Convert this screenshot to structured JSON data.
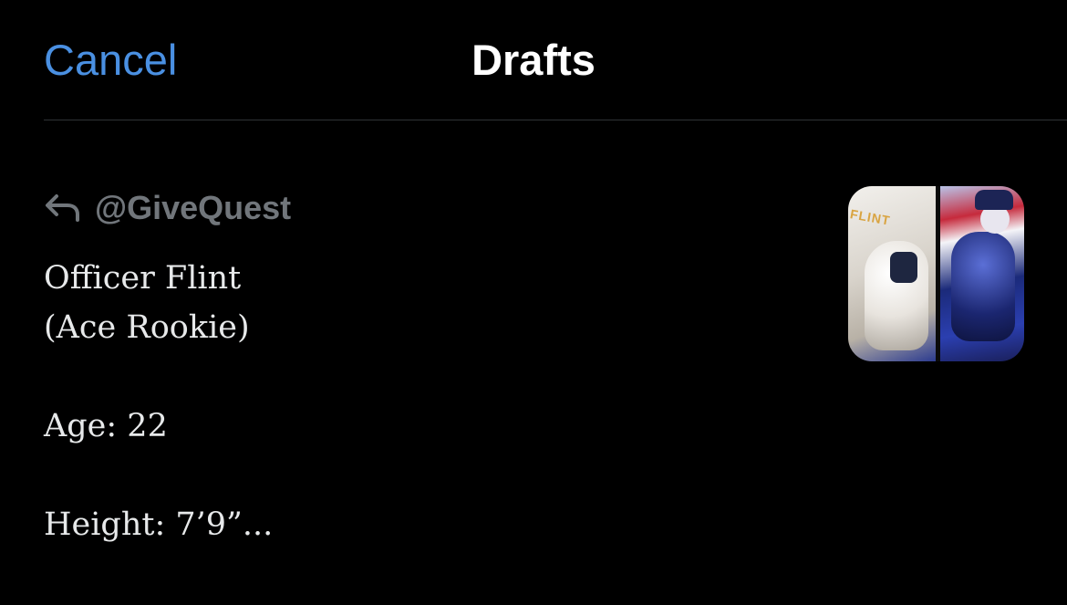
{
  "header": {
    "cancel_label": "Cancel",
    "title": "Drafts"
  },
  "colors": {
    "background": "#000000",
    "accent": "#4a90e2",
    "muted": "#71767b",
    "text": "#e7e9ea",
    "divider": "#2f3336"
  },
  "draft": {
    "reply_icon": "reply-arrow-icon",
    "reply_handle": "@GiveQuest",
    "text": "Officer Flint\n(Ace Rookie)\n\nAge: 22\n\nHeight: 7’9”...",
    "thumbnail": {
      "alt": "character-artwork-thumbnail",
      "logo_text": "FLINT"
    }
  }
}
